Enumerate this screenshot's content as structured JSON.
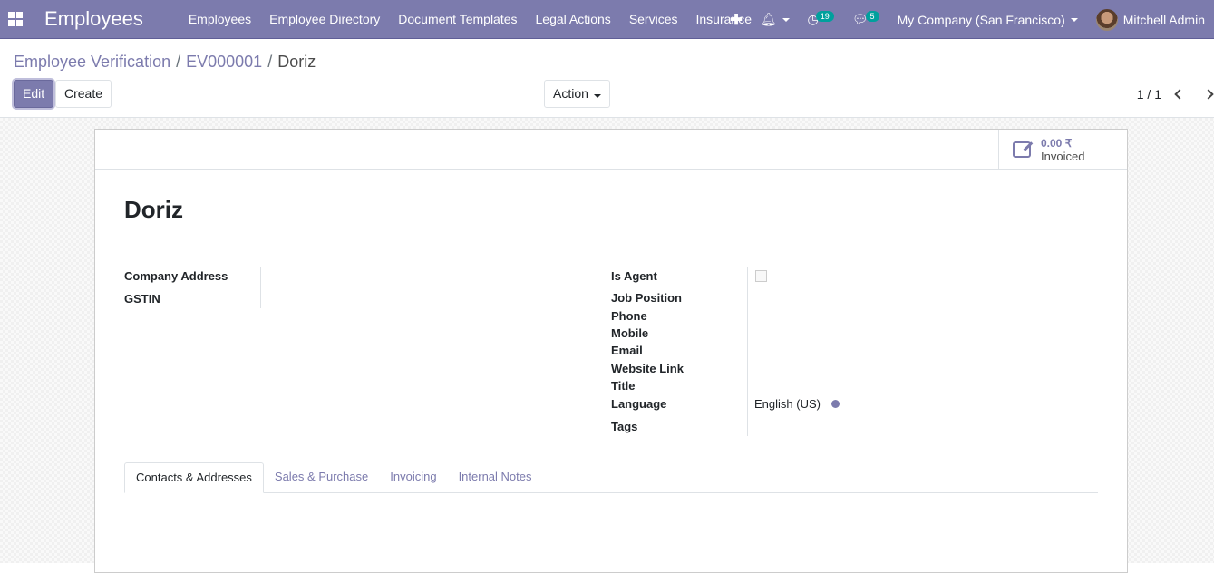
{
  "navbar": {
    "app_title": "Employees",
    "menu": [
      "Employees",
      "Employee Directory",
      "Document Templates",
      "Legal Actions",
      "Services",
      "Insurance"
    ],
    "activity_count": "19",
    "message_count": "5",
    "company": "My Company (San Francisco)",
    "user": "Mitchell Admin"
  },
  "breadcrumb": {
    "items": [
      "Employee Verification",
      "EV000001"
    ],
    "current": "Doriz",
    "separator": "/"
  },
  "toolbar": {
    "edit": "Edit",
    "create": "Create",
    "action": "Action",
    "pager": "1 / 1"
  },
  "stat_button": {
    "value": "0.00 ₹",
    "label": "Invoiced"
  },
  "record": {
    "name": "Doriz"
  },
  "left_fields": [
    {
      "label": "Company Address",
      "value": ""
    },
    {
      "label": "GSTIN",
      "value": ""
    }
  ],
  "right_fields": [
    {
      "label": "Is Agent",
      "value": ""
    },
    {
      "label": "Job Position",
      "value": ""
    },
    {
      "label": "Phone",
      "value": ""
    },
    {
      "label": "Mobile",
      "value": ""
    },
    {
      "label": "Email",
      "value": ""
    },
    {
      "label": "Website Link",
      "value": ""
    },
    {
      "label": "Title",
      "value": ""
    },
    {
      "label": "Language",
      "value": "English (US)"
    },
    {
      "label": "Tags",
      "value": ""
    }
  ],
  "tabs": [
    "Contacts & Addresses",
    "Sales & Purchase",
    "Invoicing",
    "Internal Notes"
  ]
}
